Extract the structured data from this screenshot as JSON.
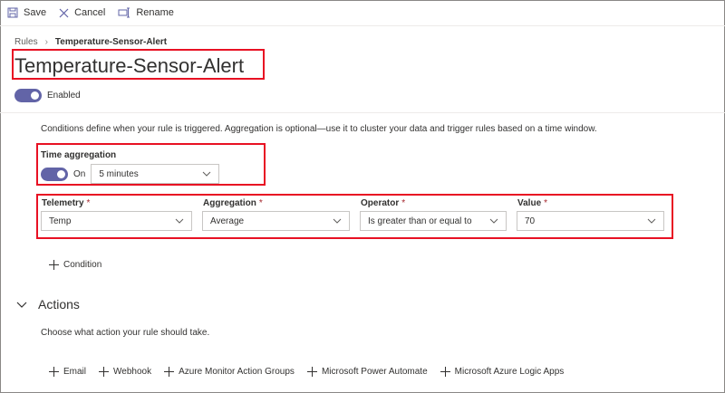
{
  "toolbar": {
    "save_label": "Save",
    "cancel_label": "Cancel",
    "rename_label": "Rename"
  },
  "breadcrumb": {
    "root": "Rules",
    "current": "Temperature-Sensor-Alert"
  },
  "page": {
    "title": "Temperature-Sensor-Alert",
    "enabled_label": "Enabled",
    "enabled": true,
    "description": "Conditions define when your rule is triggered. Aggregation is optional—use it to cluster your data and trigger rules based on a time window."
  },
  "time_aggregation": {
    "label": "Time aggregation",
    "toggle_label": "On",
    "enabled": true,
    "window": "5 minutes"
  },
  "condition": {
    "telemetry_label": "Telemetry",
    "telemetry_value": "Temp",
    "aggregation_label": "Aggregation",
    "aggregation_value": "Average",
    "operator_label": "Operator",
    "operator_value": "Is greater than or equal to",
    "value_label": "Value",
    "value_value": "70",
    "required_marker": "*",
    "add_condition_label": "Condition"
  },
  "actions": {
    "title": "Actions",
    "description": "Choose what action your rule should take.",
    "links": [
      "Email",
      "Webhook",
      "Azure Monitor Action Groups",
      "Microsoft Power Automate",
      "Microsoft Azure Logic Apps"
    ]
  },
  "colors": {
    "accent": "#6264a7",
    "highlight": "#e81123",
    "required": "#a4262c"
  }
}
